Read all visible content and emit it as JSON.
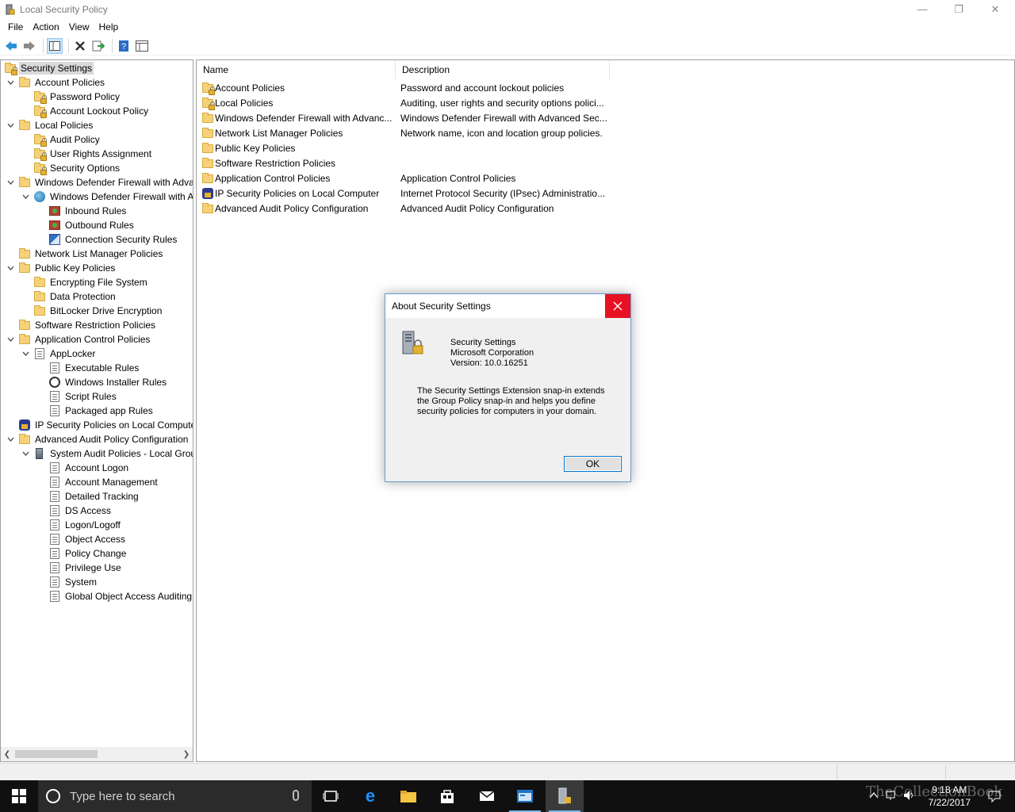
{
  "window": {
    "title": "Local Security Policy",
    "minimize_glyph": "—",
    "restore_glyph": "❐",
    "close_glyph": "✕"
  },
  "menu": [
    "File",
    "Action",
    "View",
    "Help"
  ],
  "toolbar": {
    "buttons": [
      "back-icon",
      "forward-icon",
      "show-hide-tree-icon",
      "delete-icon",
      "export-list-icon",
      "help-icon",
      "properties-icon"
    ]
  },
  "tree": {
    "items": [
      {
        "label": "Security Settings",
        "icon": "lock-folder-icon",
        "expanded": null,
        "selected": true
      },
      {
        "label": "Account Policies",
        "icon": "folder-icon",
        "expanded": true
      },
      {
        "label": "Password Policy",
        "icon": "lock-folder-icon",
        "expanded": null
      },
      {
        "label": "Account Lockout Policy",
        "icon": "lock-folder-icon",
        "expanded": null
      },
      {
        "label": "Local Policies",
        "icon": "folder-icon",
        "expanded": true
      },
      {
        "label": "Audit Policy",
        "icon": "lock-folder-icon",
        "expanded": null
      },
      {
        "label": "User Rights Assignment",
        "icon": "lock-folder-icon",
        "expanded": null
      },
      {
        "label": "Security Options",
        "icon": "lock-folder-icon",
        "expanded": null
      },
      {
        "label": "Windows Defender Firewall with Adva",
        "icon": "folder-icon",
        "expanded": true
      },
      {
        "label": "Windows Defender Firewall with A",
        "icon": "globe-icon",
        "expanded": true
      },
      {
        "label": "Inbound Rules",
        "icon": "firewall-icon",
        "expanded": null
      },
      {
        "label": "Outbound Rules",
        "icon": "firewall-icon",
        "expanded": null
      },
      {
        "label": "Connection Security Rules",
        "icon": "connection-icon",
        "expanded": null
      },
      {
        "label": "Network List Manager Policies",
        "icon": "folder-icon",
        "expanded": null
      },
      {
        "label": "Public Key Policies",
        "icon": "folder-icon",
        "expanded": true
      },
      {
        "label": "Encrypting File System",
        "icon": "folder-icon",
        "expanded": null
      },
      {
        "label": "Data Protection",
        "icon": "folder-icon",
        "expanded": null
      },
      {
        "label": "BitLocker Drive Encryption",
        "icon": "folder-icon",
        "expanded": null
      },
      {
        "label": "Software Restriction Policies",
        "icon": "folder-icon",
        "expanded": null
      },
      {
        "label": "Application Control Policies",
        "icon": "folder-icon",
        "expanded": true
      },
      {
        "label": "AppLocker",
        "icon": "applocker-icon",
        "expanded": true
      },
      {
        "label": "Executable Rules",
        "icon": "doc-icon",
        "expanded": null
      },
      {
        "label": "Windows Installer Rules",
        "icon": "gear-icon",
        "expanded": null
      },
      {
        "label": "Script Rules",
        "icon": "doc-icon",
        "expanded": null
      },
      {
        "label": "Packaged app Rules",
        "icon": "doc-icon",
        "expanded": null
      },
      {
        "label": "IP Security Policies on Local Compute",
        "icon": "ipsec-icon",
        "expanded": null
      },
      {
        "label": "Advanced Audit Policy Configuration",
        "icon": "folder-icon",
        "expanded": true
      },
      {
        "label": "System Audit Policies - Local Grou",
        "icon": "server-icon",
        "expanded": true
      },
      {
        "label": "Account Logon",
        "icon": "doc-icon",
        "expanded": null
      },
      {
        "label": "Account Management",
        "icon": "doc-icon",
        "expanded": null
      },
      {
        "label": "Detailed Tracking",
        "icon": "doc-icon",
        "expanded": null
      },
      {
        "label": "DS Access",
        "icon": "doc-icon",
        "expanded": null
      },
      {
        "label": "Logon/Logoff",
        "icon": "doc-icon",
        "expanded": null
      },
      {
        "label": "Object Access",
        "icon": "doc-icon",
        "expanded": null
      },
      {
        "label": "Policy Change",
        "icon": "doc-icon",
        "expanded": null
      },
      {
        "label": "Privilege Use",
        "icon": "doc-icon",
        "expanded": null
      },
      {
        "label": "System",
        "icon": "doc-icon",
        "expanded": null
      },
      {
        "label": "Global Object Access Auditing",
        "icon": "doc-icon",
        "expanded": null
      }
    ]
  },
  "list": {
    "columns": [
      "Name",
      "Description"
    ],
    "rows": [
      {
        "name": "Account Policies",
        "description": "Password and account lockout policies",
        "icon": "lock-folder-icon"
      },
      {
        "name": "Local Policies",
        "description": "Auditing, user rights and security options polici...",
        "icon": "lock-folder-icon"
      },
      {
        "name": "Windows Defender Firewall with Advanc...",
        "description": "Windows Defender Firewall with Advanced Sec...",
        "icon": "folder-icon"
      },
      {
        "name": "Network List Manager Policies",
        "description": "Network name, icon and location group policies.",
        "icon": "folder-icon"
      },
      {
        "name": "Public Key Policies",
        "description": "",
        "icon": "folder-icon"
      },
      {
        "name": "Software Restriction Policies",
        "description": "",
        "icon": "folder-icon"
      },
      {
        "name": "Application Control Policies",
        "description": "Application Control Policies",
        "icon": "folder-icon"
      },
      {
        "name": "IP Security Policies on Local Computer",
        "description": "Internet Protocol Security (IPsec) Administratio...",
        "icon": "ipsec-icon"
      },
      {
        "name": "Advanced Audit Policy Configuration",
        "description": "Advanced Audit Policy Configuration",
        "icon": "folder-icon"
      }
    ]
  },
  "dialog": {
    "title": "About Security Settings",
    "product": "Security Settings",
    "company": "Microsoft Corporation",
    "version": "Version: 10.0.16251",
    "blurb": "The Security Settings Extension snap-in extends the Group Policy snap-in and helps you define security policies for computers in your domain.",
    "ok_label": "OK"
  },
  "taskbar": {
    "search_placeholder": "Type here to search",
    "time": "9:18 AM",
    "date": "7/22/2017",
    "watermark": "TheCollectionBook"
  },
  "colors": {
    "accent": "#0078d7",
    "close_red": "#e81123",
    "taskbar": "#101010"
  }
}
